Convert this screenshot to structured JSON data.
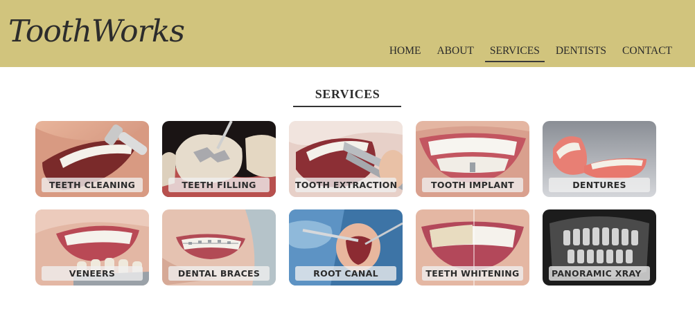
{
  "header": {
    "logo": "ToothWorks",
    "nav": [
      "HOME",
      "ABOUT",
      "SERVICES",
      "DENTISTS",
      "CONTACT"
    ],
    "active": "SERVICES",
    "bg_color": "#d1c47d"
  },
  "main": {
    "title": "SERVICES",
    "services": [
      {
        "label": "TEETH CLEANING",
        "icon": "teeth-cleaning-photo"
      },
      {
        "label": "TEETH FILLING",
        "icon": "teeth-filling-photo"
      },
      {
        "label": "TOOTH EXTRACTION",
        "icon": "tooth-extraction-photo"
      },
      {
        "label": "TOOTH IMPLANT",
        "icon": "tooth-implant-photo"
      },
      {
        "label": "DENTURES",
        "icon": "dentures-photo"
      },
      {
        "label": "VENEERS",
        "icon": "veneers-photo"
      },
      {
        "label": "DENTAL BRACES",
        "icon": "dental-braces-photo"
      },
      {
        "label": "ROOT CANAL",
        "icon": "root-canal-photo"
      },
      {
        "label": "TEETH WHITENING",
        "icon": "teeth-whitening-photo"
      },
      {
        "label": "PANORAMIC XRAY",
        "icon": "panoramic-xray-photo"
      }
    ]
  }
}
